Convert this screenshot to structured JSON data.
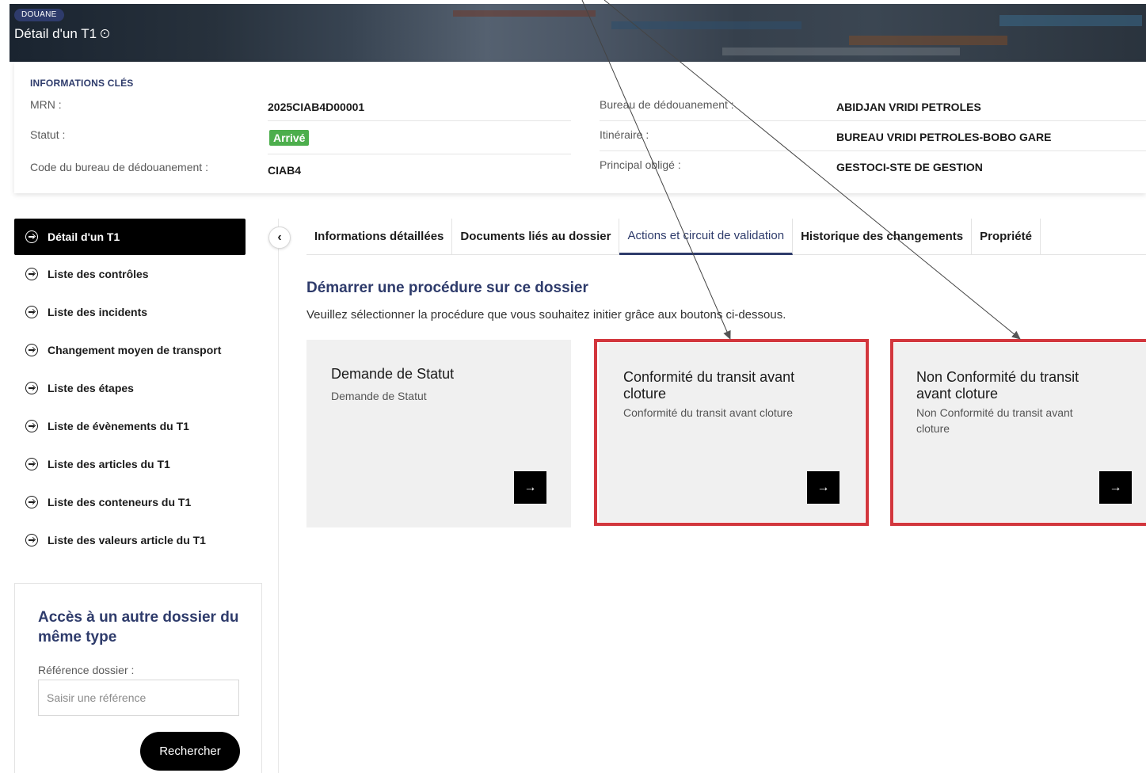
{
  "banner": {
    "badge": "DOUANE",
    "title": "Détail d'un T1"
  },
  "key_info": {
    "header": "INFORMATIONS CLÉS",
    "left": [
      {
        "label": "MRN :",
        "value": "2025CIAB4D00001"
      },
      {
        "label": "Statut :",
        "value": "Arrivé"
      },
      {
        "label": "Code du bureau de dédouanement :",
        "value": "CIAB4"
      }
    ],
    "right": [
      {
        "label": "Bureau de dédouanement :",
        "value": "ABIDJAN VRIDI PETROLES"
      },
      {
        "label": "Itinéraire :",
        "value": "BUREAU VRIDI PETROLES-BOBO GARE"
      },
      {
        "label": "Principal obligé :",
        "value": "GESTOCI-STE DE GESTION"
      }
    ]
  },
  "sidebar": {
    "items": [
      {
        "label": "Détail d'un T1",
        "active": true
      },
      {
        "label": "Liste des contrôles"
      },
      {
        "label": "Liste des incidents"
      },
      {
        "label": "Changement moyen de transport"
      },
      {
        "label": "Liste des étapes"
      },
      {
        "label": "Liste de évènements du T1"
      },
      {
        "label": "Liste des articles du T1"
      },
      {
        "label": "Liste des conteneurs du T1"
      },
      {
        "label": "Liste des valeurs article du T1"
      }
    ],
    "collapse_glyph": "‹"
  },
  "search": {
    "title": "Accès à un autre dossier du même type",
    "label": "Référence dossier :",
    "placeholder": "Saisir une référence",
    "button": "Rechercher"
  },
  "tabs": [
    {
      "label": "Informations détaillées"
    },
    {
      "label": "Documents liés au dossier"
    },
    {
      "label": "Actions et circuit de validation",
      "active": true
    },
    {
      "label": "Historique des changements"
    },
    {
      "label": "Propriété"
    }
  ],
  "procedure": {
    "title": "Démarrer une procédure sur ce dossier",
    "description": "Veuillez sélectionner la procédure que vous souhaitez initier grâce aux boutons ci-dessous.",
    "cards": [
      {
        "title": "Demande de Statut",
        "subtitle": "Demande de Statut",
        "arrow": "→"
      },
      {
        "title": "Conformité du transit avant cloture",
        "subtitle": "Conformité du transit avant cloture",
        "arrow": "→"
      },
      {
        "title": "Non Conformité du transit avant cloture",
        "subtitle": "Non Conformité du transit avant cloture",
        "arrow": "→"
      }
    ]
  },
  "colors": {
    "accent": "#2e3b6b",
    "status_green": "#4cae4c",
    "highlight_red": "#d2363d",
    "card_bg": "#f0f0f0"
  }
}
